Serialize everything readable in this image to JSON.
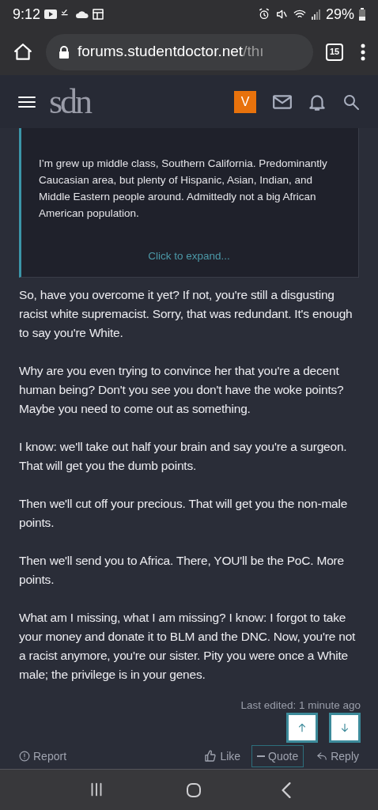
{
  "status_bar": {
    "time": "9:12",
    "battery": "29%"
  },
  "browser": {
    "url_host": "forums.studentdoctor.net",
    "url_path": "/thı",
    "tab_count": "15"
  },
  "site_header": {
    "logo": "sdn",
    "avatar_letter": "V"
  },
  "quote": {
    "text": "I’m grew up middle class, Southern California. Predominantly Caucasian area, but plenty of Hispanic, Asian, Indian, and Middle Eastern people around. Admittedly not a big African American population.",
    "expand": "Click to expand..."
  },
  "paragraphs": [
    "So, have you overcome it yet? If not, you're still a disgusting racist white supremacist. Sorry, that was redundant. It's enough to say you're White.",
    "Why are you even trying to convince her that you're a decent human being? Don't you see you don't have the woke points? Maybe you need to come out as something.",
    "I know: we'll take out half your brain and say you're a surgeon. That will get you the dumb points.",
    "Then we'll cut off your precious. That will get you the non-male points.",
    "Then we'll send you to Africa. There, YOU'll be the PoC. More points.",
    "What am I missing, what I am missing? I know: I forgot to take your money and donate it to BLM and the DNC. Now, you're not a racist anymore, you're our sister. Pity you were once a White male; the privilege is in your genes."
  ],
  "last_edited": "Last edited: 1 minute ago",
  "actions": {
    "report": "Report",
    "like": "Like",
    "quote": "Quote",
    "reply": "Reply"
  }
}
